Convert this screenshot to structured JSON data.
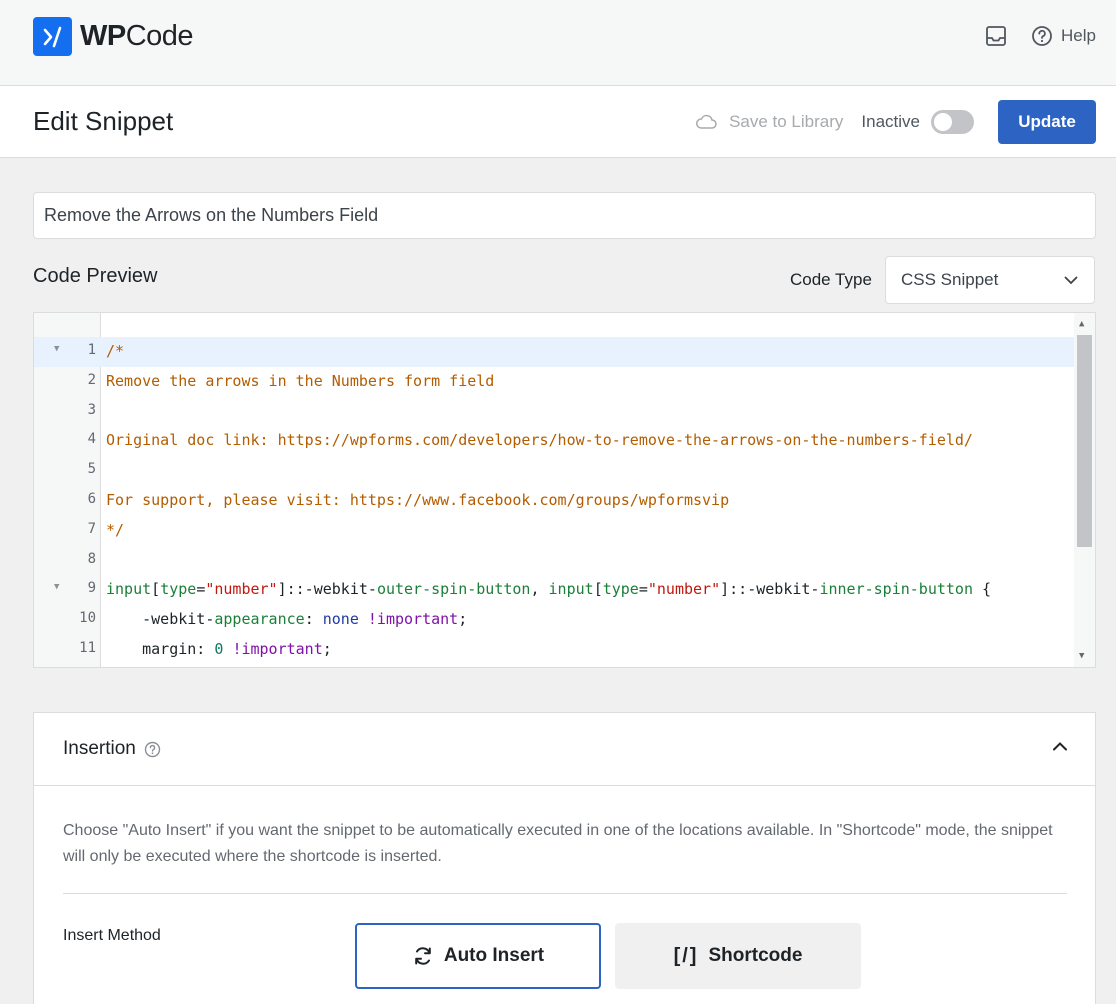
{
  "brand": {
    "name_bold": "WP",
    "name_rest": "Code"
  },
  "topbar": {
    "help_label": "Help"
  },
  "header": {
    "title": "Edit Snippet",
    "save_to_library": "Save to Library",
    "status": "Inactive",
    "update_label": "Update"
  },
  "snippet": {
    "title": "Remove the Arrows on the Numbers Field"
  },
  "code_preview": {
    "label": "Code Preview",
    "code_type_label": "Code Type",
    "code_type_value": "CSS Snippet",
    "line_numbers": [
      "1",
      "2",
      "3",
      "4",
      "5",
      "6",
      "7",
      "8",
      "9",
      "10",
      "11"
    ],
    "lines": [
      "/*",
      "Remove the arrows in the Numbers form field",
      "",
      "Original doc link: https://wpforms.com/developers/how-to-remove-the-arrows-on-the-numbers-field/",
      "",
      "For support, please visit: https://www.facebook.com/groups/wpformsvip",
      "*/",
      "",
      "input[type=\"number\"]::-webkit-outer-spin-button, input[type=\"number\"]::-webkit-inner-spin-button {",
      "    -webkit-appearance: none !important;",
      "    margin: 0 !important;"
    ]
  },
  "insertion": {
    "title": "Insertion",
    "description": "Choose \"Auto Insert\" if you want the snippet to be automatically executed in one of the locations available. In \"Shortcode\" mode, the snippet will only be executed where the shortcode is inserted.",
    "insert_method_label": "Insert Method",
    "auto_insert_label": "Auto Insert",
    "shortcode_glyph": "[/]",
    "shortcode_label": "Shortcode"
  },
  "colors": {
    "accent": "#2d64c4",
    "logo": "#136ff0",
    "comment": "#b35c00"
  }
}
